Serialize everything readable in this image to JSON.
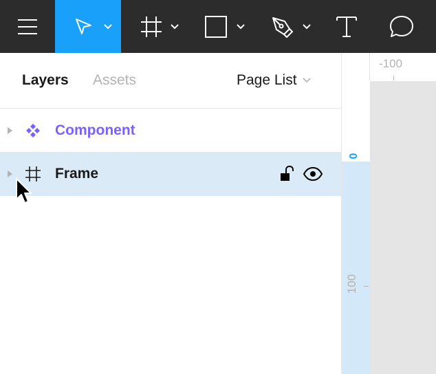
{
  "toolbar": {
    "tools": [
      {
        "icon": "hamburger-menu-icon",
        "active": false
      },
      {
        "icon": "move-pointer-icon",
        "active": true,
        "has_dropdown": true
      },
      {
        "icon": "frame-hash-icon",
        "active": false,
        "has_dropdown": true
      },
      {
        "icon": "rectangle-icon",
        "active": false,
        "has_dropdown": true
      },
      {
        "icon": "pen-icon",
        "active": false,
        "has_dropdown": true
      },
      {
        "icon": "text-icon",
        "active": false
      },
      {
        "icon": "comment-icon",
        "active": false
      }
    ],
    "active_color": "#18a0fb",
    "bg_color": "#2c2c2c"
  },
  "panel": {
    "tabs": [
      {
        "label": "Layers",
        "active": true
      },
      {
        "label": "Assets",
        "active": false
      }
    ],
    "page_list_label": "Page List",
    "layers": [
      {
        "name": "Component",
        "icon": "component-icon",
        "selected": false,
        "color": "#7b61ff"
      },
      {
        "name": "Frame",
        "icon": "frame-hash-icon",
        "selected": true,
        "locked": false,
        "visible": true
      }
    ],
    "selected_row_color": "#daebf7"
  },
  "ruler": {
    "top_label": "-100",
    "left_zero": "0",
    "left_100": "100"
  }
}
